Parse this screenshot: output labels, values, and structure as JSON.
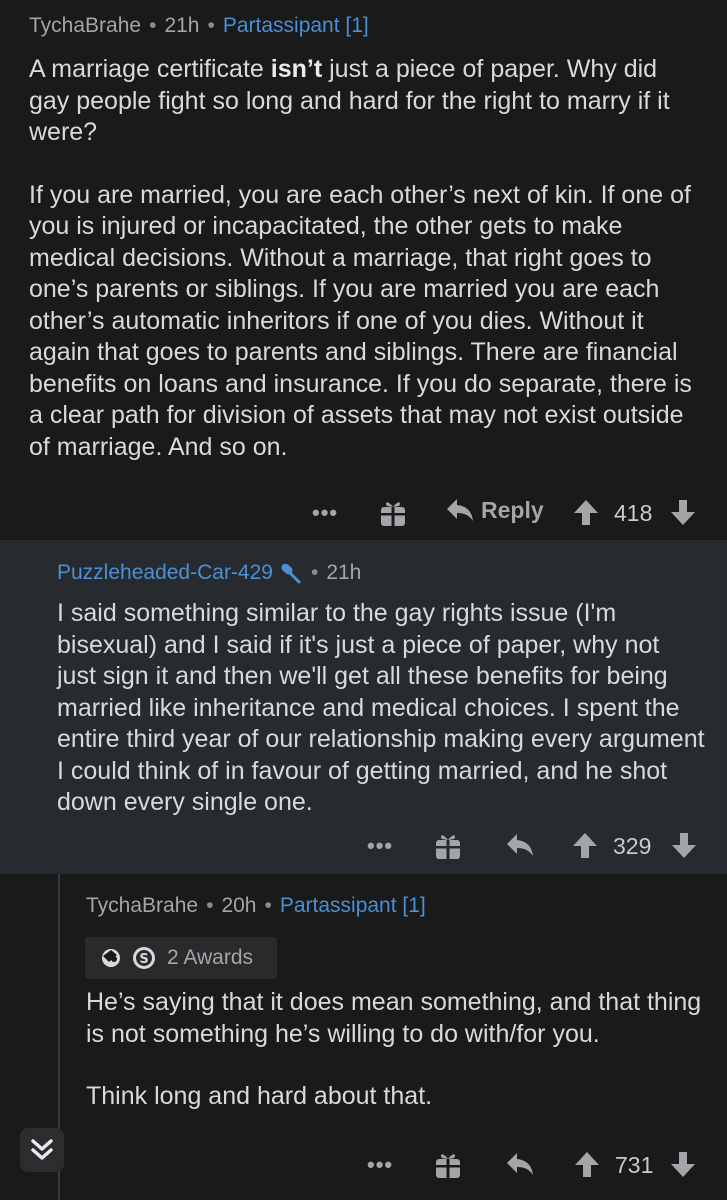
{
  "comments": [
    {
      "author": "TychaBrahe",
      "age": "21h",
      "flair": "Partassipant [1]",
      "paragraphs": [
        [
          "A marriage certificate ",
          "isn’t",
          " just a piece of paper. Why did gay people fight so long and hard for the right to marry if it were?"
        ],
        "If you are married, you are each other’s next of kin. If one of you is injured or incapacitated, the other gets to make medical decisions. Without a marriage, that right goes to one’s parents or siblings. If you are married you are each other’s automatic inheritors if one of you dies. Without it again that goes to parents and siblings. There are financial benefits on loans and insurance. If you do separate, there is a clear path for division of assets that may not exist outside of marriage. And so on."
      ],
      "more_label": "•••",
      "reply_label": "Reply",
      "score": "418"
    },
    {
      "author": "Puzzleheaded-Car-429",
      "age": "21h",
      "body": "I said something similar to the gay rights issue (I'm bisexual) and I said if it's just a piece of paper, why not just sign it and then we'll get all these benefits for being married like inheritance and medical choices. I spent the entire third year of our relationship making every argument I could think of in favour of getting married, and he shot down every single one.",
      "more_label": "•••",
      "score": "329"
    },
    {
      "author": "TychaBrahe",
      "age": "20h",
      "flair": "Partassipant [1]",
      "awards_label": "2 Awards",
      "paragraphs": [
        "He’s saying that it does mean something, and that thing is not something he’s willing to do with/for you.",
        "Think long and hard about that."
      ],
      "more_label": "•••",
      "score": "731"
    }
  ],
  "colors": {
    "background": "#1a1a1b",
    "highlight_background": "#272b30",
    "flair_blue": "#4b8fd6",
    "text": "#d7dadc",
    "meta": "#a3a5a8"
  },
  "icons": [
    "gift-icon",
    "reply-arrow-icon",
    "upvote-icon",
    "downvote-icon",
    "op-microphone-icon",
    "award-icon",
    "collapse-chevrons-icon"
  ]
}
